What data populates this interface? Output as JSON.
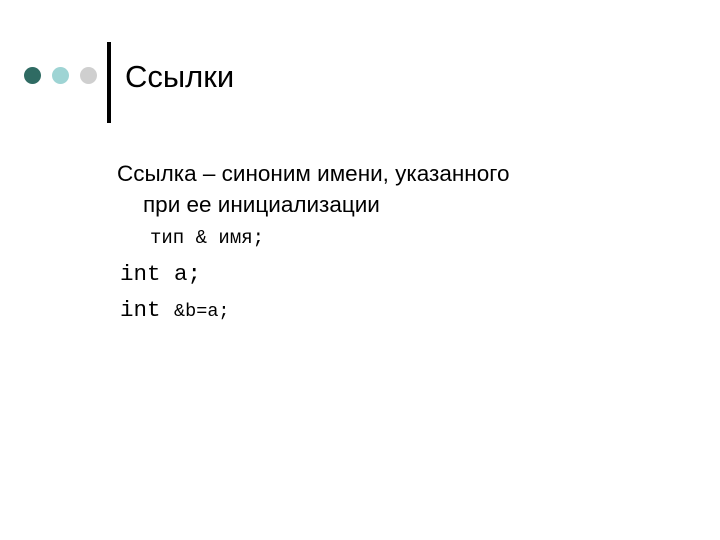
{
  "slide": {
    "title": "Ссылки",
    "background_color": "#FFFFFF",
    "decoration": {
      "dots": [
        {
          "name": "dot-dark-teal",
          "color": "#2F6B63"
        },
        {
          "name": "dot-light-teal",
          "color": "#9ED4D4"
        },
        {
          "name": "dot-gray",
          "color": "#CFCFCF"
        }
      ],
      "rule_color": "#000000"
    },
    "body": {
      "bullet": {
        "line1": "Ссылка – синоним имени, указанного",
        "line2": "при ее инициализации"
      },
      "code_lines": [
        {
          "text": "тип & имя;"
        },
        {
          "text": "int a;"
        }
      ],
      "code_last": {
        "prefix": "int ",
        "suffix": "&b=a;"
      }
    }
  }
}
